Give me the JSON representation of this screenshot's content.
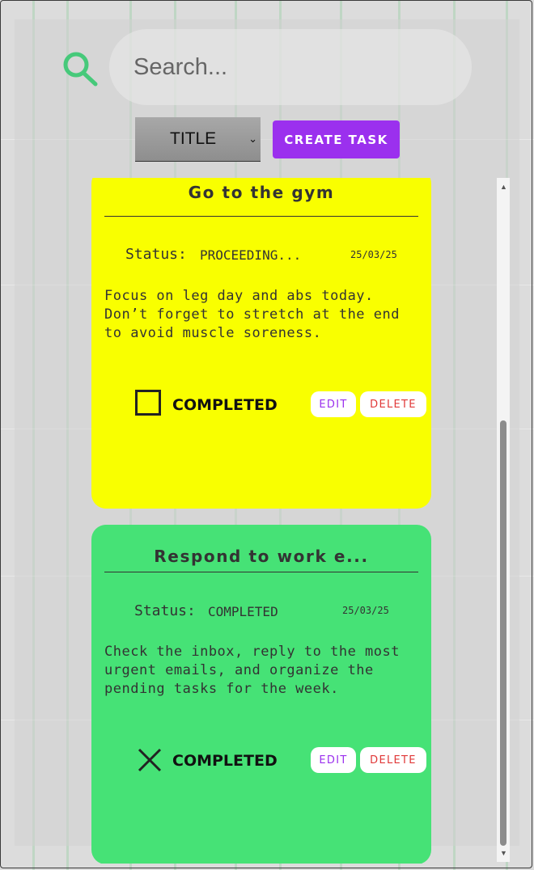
{
  "search": {
    "placeholder": "Search..."
  },
  "controls": {
    "sort_selected": "TITLE",
    "create_label": "CREATE TASK"
  },
  "colors": {
    "accent": "#9b30ee",
    "delete": "#e03838",
    "card_proceeding": "#f9ff00",
    "card_completed": "#46e276",
    "search_icon": "#46c97a"
  },
  "tasks": [
    {
      "title": "Go to the gym",
      "status_label": "Status:",
      "status": "PROCEEDING...",
      "date": "25/03/25",
      "description": "Focus on leg day and abs today. Don’t forget to stretch at the end to avoid muscle soreness.",
      "completed_label": "COMPLETED",
      "completed": false,
      "edit_label": "EDIT",
      "delete_label": "DELETE"
    },
    {
      "title": "Respond to work e...",
      "status_label": "Status:",
      "status": "COMPLETED",
      "date": "25/03/25",
      "description": "Check the inbox, reply to the most urgent emails, and organize the pending tasks for the week.",
      "completed_label": "COMPLETED",
      "completed": true,
      "edit_label": "EDIT",
      "delete_label": "DELETE"
    }
  ]
}
